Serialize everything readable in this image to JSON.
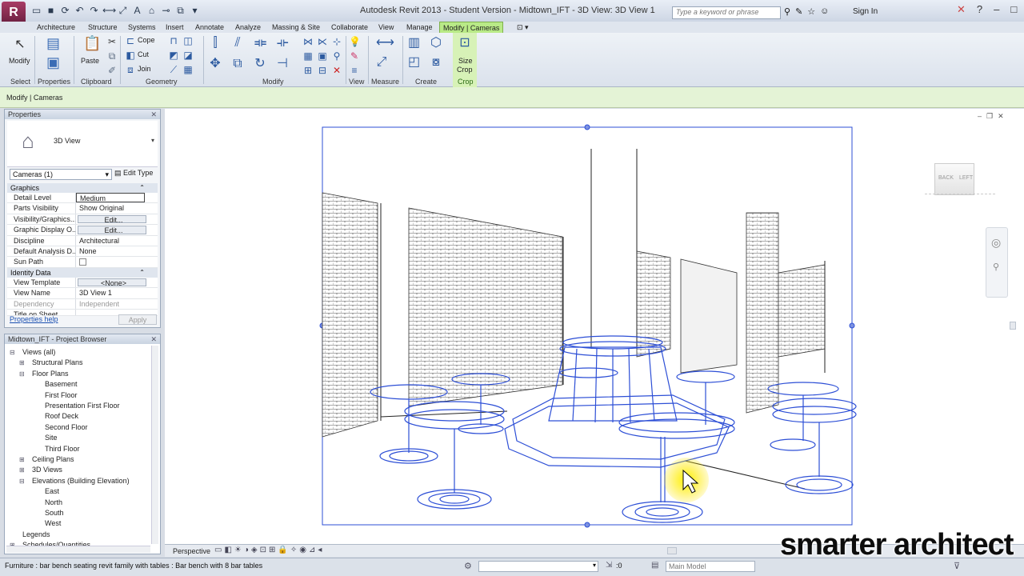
{
  "app": {
    "window_title": "Autodesk Revit 2013 - Student Version   -   Midtown_IFT - 3D View: 3D View 1",
    "search_placeholder": "Type a keyword or phrase",
    "sign_in": "Sign In"
  },
  "ribbon": {
    "tabs": [
      "Architecture",
      "Structure",
      "Systems",
      "Insert",
      "Annotate",
      "Analyze",
      "Massing & Site",
      "Collaborate",
      "View",
      "Manage",
      "Modify | Cameras"
    ],
    "active_tab": "Modify | Cameras",
    "panels": [
      "Select",
      "Properties",
      "Clipboard",
      "Geometry",
      "Modify",
      "View",
      "Measure",
      "Create",
      "Crop"
    ],
    "modify_label": "Modify",
    "paste_label": "Paste",
    "cope_label": "Cope",
    "cut_label": "Cut",
    "join_label": "Join",
    "size_crop_line1": "Size",
    "size_crop_line2": "Crop",
    "context_label": "Modify | Cameras"
  },
  "properties": {
    "title": "Properties",
    "type_name": "3D View",
    "instance_filter": "Cameras (1)",
    "edit_type": "Edit Type",
    "sections": {
      "graphics": "Graphics",
      "identity": "Identity Data"
    },
    "rows": [
      {
        "name": "Detail Level",
        "value": "Medium"
      },
      {
        "name": "Parts Visibility",
        "value": "Show Original"
      },
      {
        "name": "Visibility/Graphics...",
        "value": "Edit..."
      },
      {
        "name": "Graphic Display O...",
        "value": "Edit..."
      },
      {
        "name": "Discipline",
        "value": "Architectural"
      },
      {
        "name": "Default Analysis D...",
        "value": "None"
      },
      {
        "name": "Sun Path",
        "value": ""
      }
    ],
    "identity_rows": [
      {
        "name": "View Template",
        "value": "<None>"
      },
      {
        "name": "View Name",
        "value": "3D View 1"
      },
      {
        "name": "Dependency",
        "value": "Independent"
      },
      {
        "name": "Title on Sheet",
        "value": ""
      }
    ],
    "help_link": "Properties help",
    "apply": "Apply"
  },
  "browser": {
    "title": "Midtown_IFT - Project Browser",
    "items": [
      {
        "label": "Views (all)",
        "level": 0,
        "toggle": "−"
      },
      {
        "label": "Structural Plans",
        "level": 1,
        "toggle": "+"
      },
      {
        "label": "Floor Plans",
        "level": 1,
        "toggle": "−"
      },
      {
        "label": "Basement",
        "level": 2,
        "toggle": ""
      },
      {
        "label": "First Floor",
        "level": 2,
        "toggle": ""
      },
      {
        "label": "Presentation First Floor",
        "level": 2,
        "toggle": ""
      },
      {
        "label": "Roof Deck",
        "level": 2,
        "toggle": ""
      },
      {
        "label": "Second Floor",
        "level": 2,
        "toggle": ""
      },
      {
        "label": "Site",
        "level": 2,
        "toggle": ""
      },
      {
        "label": "Third Floor",
        "level": 2,
        "toggle": ""
      },
      {
        "label": "Ceiling Plans",
        "level": 1,
        "toggle": "+"
      },
      {
        "label": "3D Views",
        "level": 1,
        "toggle": "+"
      },
      {
        "label": "Elevations (Building Elevation)",
        "level": 1,
        "toggle": "−"
      },
      {
        "label": "East",
        "level": 2,
        "toggle": ""
      },
      {
        "label": "North",
        "level": 2,
        "toggle": ""
      },
      {
        "label": "South",
        "level": 2,
        "toggle": ""
      },
      {
        "label": "West",
        "level": 2,
        "toggle": ""
      },
      {
        "label": "Legends",
        "level": 0,
        "toggle": ""
      },
      {
        "label": "Schedules/Quantities",
        "level": 0,
        "toggle": "+"
      }
    ]
  },
  "view_bar": {
    "scale_label": "Perspective"
  },
  "viewcube": {
    "back": "BACK",
    "left": "LEFT"
  },
  "status": {
    "text": "Furniture : bar bench seating revit family with tables : Bar bench with 8 bar tables",
    "zero": ":0",
    "model": "Main Model"
  },
  "watermark": "smarter architect",
  "colors": {
    "selection_blue": "#2d4fd6",
    "active_tab_green": "#b9ea87",
    "app_button": "#8a2b52"
  }
}
